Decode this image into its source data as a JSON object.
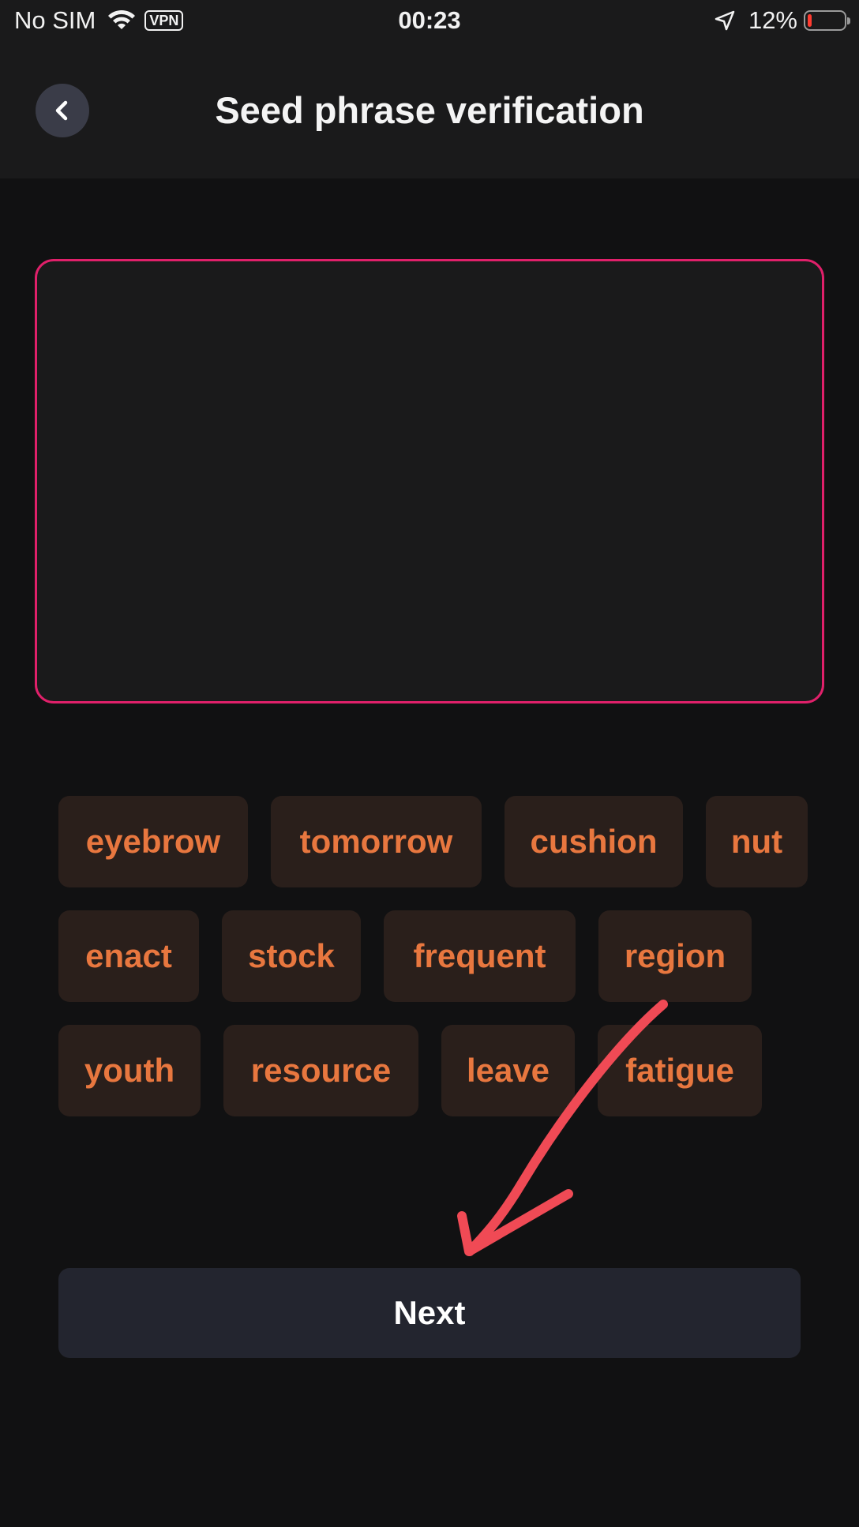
{
  "status_bar": {
    "carrier": "No SIM",
    "vpn": "VPN",
    "time": "00:23",
    "battery_percent": "12%",
    "battery_level": 0.12,
    "battery_color": "#ff3b30"
  },
  "header": {
    "title": "Seed phrase verification",
    "back_icon": "chevron-left-icon"
  },
  "phrase_box": {
    "selected_words": [],
    "border_color": "#e0206a"
  },
  "word_rows": [
    [
      "eyebrow",
      "tomorrow",
      "cushion",
      "nut"
    ],
    [
      "enact",
      "stock",
      "frequent",
      "region"
    ],
    [
      "youth",
      "resource",
      "leave",
      "fatigue"
    ]
  ],
  "word_color": "#e8773f",
  "next_button": {
    "label": "Next"
  },
  "annotation": {
    "type": "arrow",
    "color": "#f04a55"
  }
}
